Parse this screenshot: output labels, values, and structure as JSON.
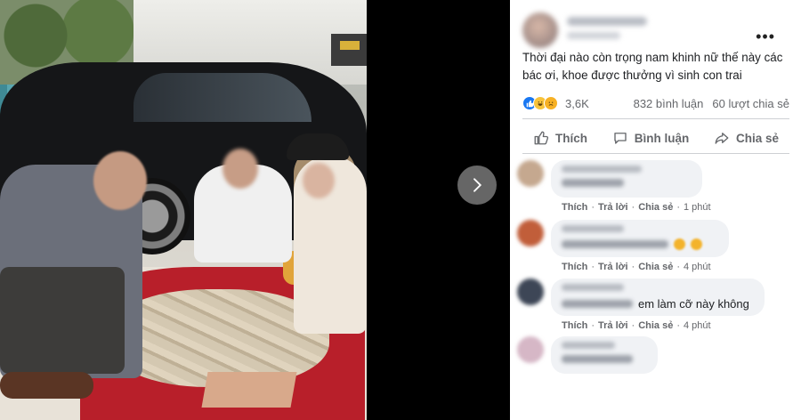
{
  "post": {
    "text": "Thời đại nào còn trọng nam khinh nữ thế này các bác ơi, khoe được thưởng vì sinh con trai",
    "more_label": "•••",
    "reaction_count": "3,6K",
    "comments_count": "832 bình luận",
    "shares_count": "60 lượt chia sẻ"
  },
  "actions": {
    "like": "Thích",
    "comment": "Bình luận",
    "share": "Chia sẻ"
  },
  "comments": [
    {
      "meta_like": "Thích",
      "meta_reply": "Trả lời",
      "meta_share": "Chia sẻ",
      "time": "1 phút"
    },
    {
      "meta_like": "Thích",
      "meta_reply": "Trả lời",
      "meta_share": "Chia sẻ",
      "time": "4 phút"
    },
    {
      "text": "em làm cỡ này không",
      "meta_like": "Thích",
      "meta_reply": "Trả lời",
      "meta_share": "Chia sẻ",
      "time": "4 phút"
    },
    {}
  ],
  "colors": {
    "accent": "#1877f2",
    "muted": "#65676b",
    "bubble": "#f0f2f5"
  },
  "icons": [
    "chevron-right-icon",
    "like-icon",
    "comment-icon",
    "share-icon",
    "haha-reaction-icon",
    "sad-reaction-icon"
  ]
}
